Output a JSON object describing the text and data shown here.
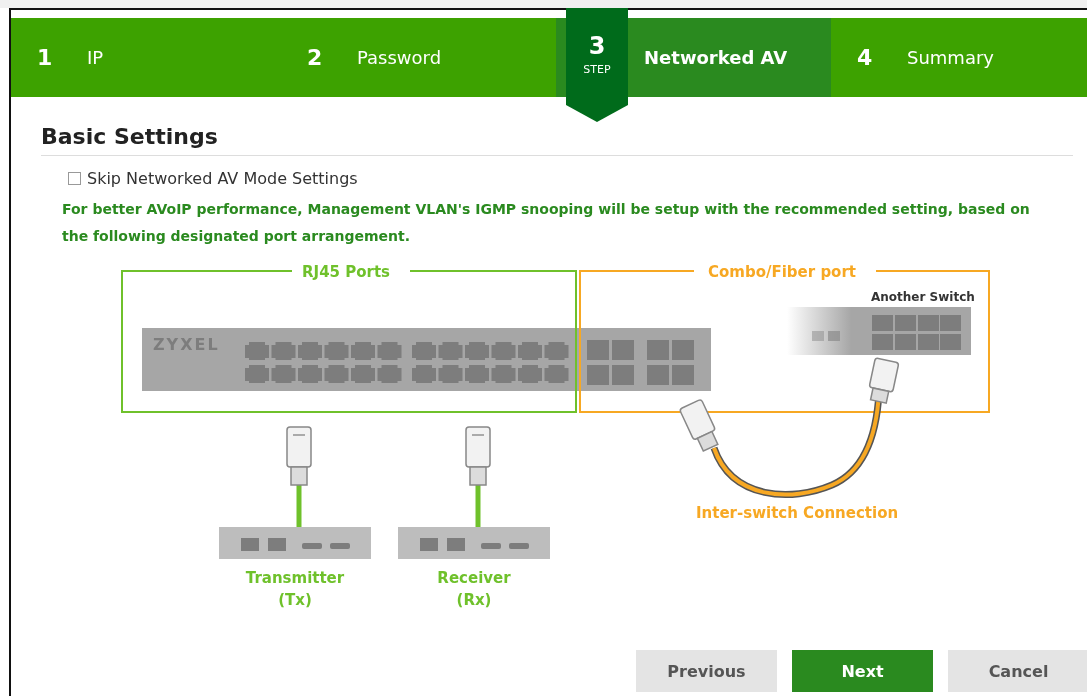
{
  "wizard": {
    "step_caption": "STEP",
    "steps": [
      {
        "number": "1",
        "label": "IP",
        "selected": false
      },
      {
        "number": "2",
        "label": "Password",
        "selected": false
      },
      {
        "number": "3",
        "label": "Networked AV",
        "selected": true
      },
      {
        "number": "4",
        "label": "Summary",
        "selected": false
      }
    ]
  },
  "section_title": "Basic Settings",
  "skip_checkbox": {
    "label": "Skip Networked AV Mode Settings",
    "checked": false
  },
  "note": "For better AVoIP performance, Management VLAN's IGMP snooping will be setup with the recommended setting, based on the following designated port arrangement.",
  "diagram": {
    "rj45_group": "RJ45 Ports",
    "fiber_group": "Combo/Fiber port",
    "switch_logo": "ZYXEL",
    "another_switch": "Another Switch",
    "devices": [
      {
        "name": "Transmitter",
        "code": "(Tx)"
      },
      {
        "name": "Receiver",
        "code": "(Rx)"
      }
    ],
    "connection_label": "Inter-switch Connection"
  },
  "buttons": [
    {
      "label": "Previous",
      "kind": "secondary"
    },
    {
      "label": "Next",
      "kind": "primary"
    },
    {
      "label": "Cancel",
      "kind": "secondary"
    }
  ]
}
